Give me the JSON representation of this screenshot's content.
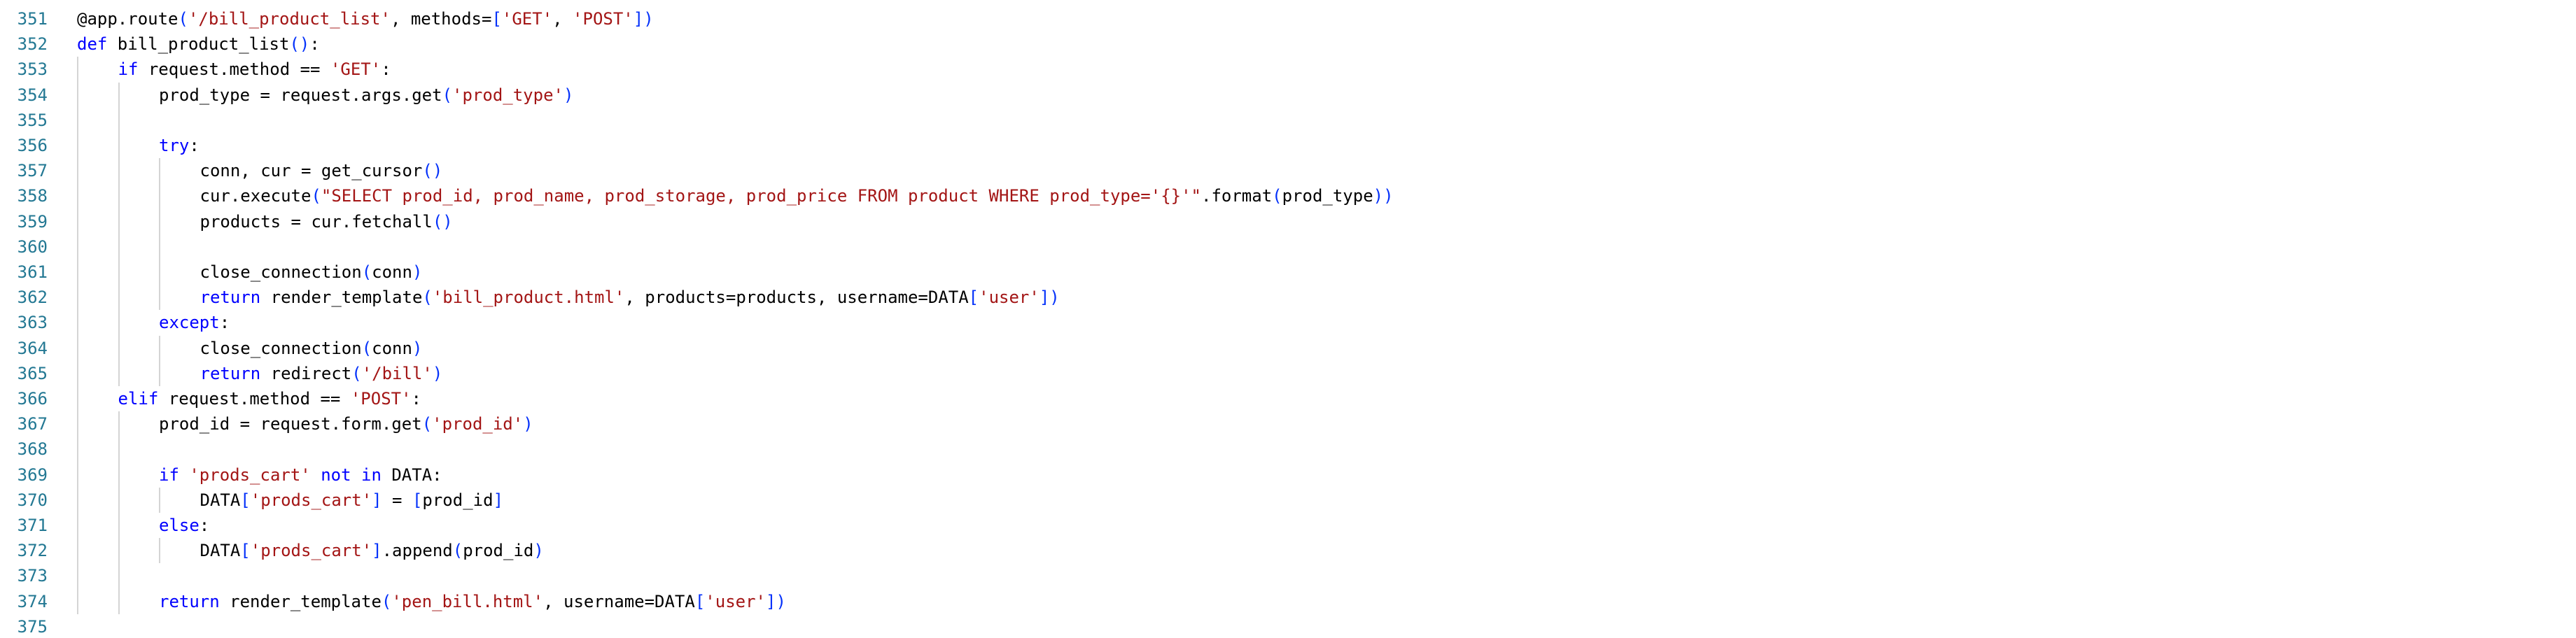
{
  "editor": {
    "colors": {
      "background": "#ffffff",
      "line_number": "#237893",
      "plain": "#000000",
      "keyword": "#0000ff",
      "string": "#a31515",
      "bracket": "#0431fa",
      "indent_guide": "#d4d4d4"
    },
    "lines": [
      {
        "num": "351",
        "indent": 0,
        "tokens": [
          [
            "pl",
            "@app.route"
          ],
          [
            "br",
            "("
          ],
          [
            "str",
            "'/bill_product_list'"
          ],
          [
            "pl",
            ", methods="
          ],
          [
            "br",
            "["
          ],
          [
            "str",
            "'GET'"
          ],
          [
            "pl",
            ", "
          ],
          [
            "str",
            "'POST'"
          ],
          [
            "br",
            "])"
          ]
        ]
      },
      {
        "num": "352",
        "indent": 0,
        "tokens": [
          [
            "kw",
            "def"
          ],
          [
            "pl",
            " bill_product_list"
          ],
          [
            "br",
            "()"
          ],
          [
            "pl",
            ":"
          ]
        ]
      },
      {
        "num": "353",
        "indent": 1,
        "tokens": [
          [
            "kw",
            "if"
          ],
          [
            "pl",
            " request.method == "
          ],
          [
            "str",
            "'GET'"
          ],
          [
            "pl",
            ":"
          ]
        ]
      },
      {
        "num": "354",
        "indent": 2,
        "tokens": [
          [
            "pl",
            "prod_type = request.args.get"
          ],
          [
            "br",
            "("
          ],
          [
            "str",
            "'prod_type'"
          ],
          [
            "br",
            ")"
          ]
        ]
      },
      {
        "num": "355",
        "indent": 0,
        "tokens": []
      },
      {
        "num": "356",
        "indent": 2,
        "tokens": [
          [
            "kw",
            "try"
          ],
          [
            "pl",
            ":"
          ]
        ]
      },
      {
        "num": "357",
        "indent": 3,
        "tokens": [
          [
            "pl",
            "conn, cur = get_cursor"
          ],
          [
            "br",
            "()"
          ]
        ]
      },
      {
        "num": "358",
        "indent": 3,
        "tokens": [
          [
            "pl",
            "cur.execute"
          ],
          [
            "br",
            "("
          ],
          [
            "str",
            "\"SELECT prod_id, prod_name, prod_storage, prod_price FROM product WHERE prod_type='{}'\""
          ],
          [
            "pl",
            ".format"
          ],
          [
            "br",
            "("
          ],
          [
            "pl",
            "prod_type"
          ],
          [
            "br",
            "))"
          ]
        ]
      },
      {
        "num": "359",
        "indent": 3,
        "tokens": [
          [
            "pl",
            "products = cur.fetchall"
          ],
          [
            "br",
            "()"
          ]
        ]
      },
      {
        "num": "360",
        "indent": 0,
        "tokens": []
      },
      {
        "num": "361",
        "indent": 3,
        "tokens": [
          [
            "pl",
            "close_connection"
          ],
          [
            "br",
            "("
          ],
          [
            "pl",
            "conn"
          ],
          [
            "br",
            ")"
          ]
        ]
      },
      {
        "num": "362",
        "indent": 3,
        "tokens": [
          [
            "kw",
            "return"
          ],
          [
            "pl",
            " render_template"
          ],
          [
            "br",
            "("
          ],
          [
            "str",
            "'bill_product.html'"
          ],
          [
            "pl",
            ", products=products, username=DATA"
          ],
          [
            "br",
            "["
          ],
          [
            "str",
            "'user'"
          ],
          [
            "br",
            "])"
          ]
        ]
      },
      {
        "num": "363",
        "indent": 2,
        "tokens": [
          [
            "kw",
            "except"
          ],
          [
            "pl",
            ":"
          ]
        ]
      },
      {
        "num": "364",
        "indent": 3,
        "tokens": [
          [
            "pl",
            "close_connection"
          ],
          [
            "br",
            "("
          ],
          [
            "pl",
            "conn"
          ],
          [
            "br",
            ")"
          ]
        ]
      },
      {
        "num": "365",
        "indent": 3,
        "tokens": [
          [
            "kw",
            "return"
          ],
          [
            "pl",
            " redirect"
          ],
          [
            "br",
            "("
          ],
          [
            "str",
            "'/bill'"
          ],
          [
            "br",
            ")"
          ]
        ]
      },
      {
        "num": "366",
        "indent": 1,
        "tokens": [
          [
            "kw",
            "elif"
          ],
          [
            "pl",
            " request.method == "
          ],
          [
            "str",
            "'POST'"
          ],
          [
            "pl",
            ":"
          ]
        ]
      },
      {
        "num": "367",
        "indent": 2,
        "tokens": [
          [
            "pl",
            "prod_id = request.form.get"
          ],
          [
            "br",
            "("
          ],
          [
            "str",
            "'prod_id'"
          ],
          [
            "br",
            ")"
          ]
        ]
      },
      {
        "num": "368",
        "indent": 0,
        "tokens": []
      },
      {
        "num": "369",
        "indent": 2,
        "tokens": [
          [
            "kw",
            "if"
          ],
          [
            "pl",
            " "
          ],
          [
            "str",
            "'prods_cart'"
          ],
          [
            "pl",
            " "
          ],
          [
            "kw",
            "not in"
          ],
          [
            "pl",
            " DATA:"
          ]
        ]
      },
      {
        "num": "370",
        "indent": 3,
        "tokens": [
          [
            "pl",
            "DATA"
          ],
          [
            "br",
            "["
          ],
          [
            "str",
            "'prods_cart'"
          ],
          [
            "br",
            "]"
          ],
          [
            "pl",
            " = "
          ],
          [
            "br",
            "["
          ],
          [
            "pl",
            "prod_id"
          ],
          [
            "br",
            "]"
          ]
        ]
      },
      {
        "num": "371",
        "indent": 2,
        "tokens": [
          [
            "kw",
            "else"
          ],
          [
            "pl",
            ":"
          ]
        ]
      },
      {
        "num": "372",
        "indent": 3,
        "tokens": [
          [
            "pl",
            "DATA"
          ],
          [
            "br",
            "["
          ],
          [
            "str",
            "'prods_cart'"
          ],
          [
            "br",
            "]"
          ],
          [
            "pl",
            ".append"
          ],
          [
            "br",
            "("
          ],
          [
            "pl",
            "prod_id"
          ],
          [
            "br",
            ")"
          ]
        ]
      },
      {
        "num": "373",
        "indent": 0,
        "tokens": []
      },
      {
        "num": "374",
        "indent": 2,
        "tokens": [
          [
            "kw",
            "return"
          ],
          [
            "pl",
            " render_template"
          ],
          [
            "br",
            "("
          ],
          [
            "str",
            "'pen_bill.html'"
          ],
          [
            "pl",
            ", username=DATA"
          ],
          [
            "br",
            "["
          ],
          [
            "str",
            "'user'"
          ],
          [
            "br",
            "])"
          ]
        ]
      },
      {
        "num": "375",
        "indent": 0,
        "tokens": []
      }
    ]
  }
}
